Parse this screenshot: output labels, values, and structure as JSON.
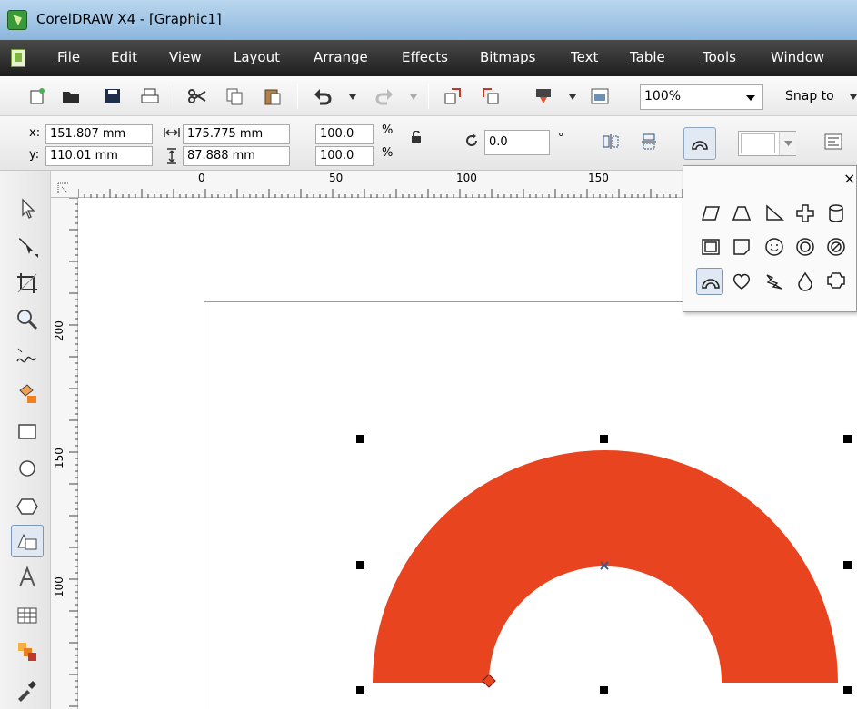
{
  "window": {
    "title": "CorelDRAW X4 - [Graphic1]"
  },
  "menu": [
    "File",
    "Edit",
    "View",
    "Layout",
    "Arrange",
    "Effects",
    "Bitmaps",
    "Text",
    "Table",
    "Tools",
    "Window"
  ],
  "toolbar": {
    "zoom": "100%",
    "snap_label": "Snap to"
  },
  "property_bar": {
    "x_label": "x:",
    "x_value": "151.807 mm",
    "y_label": "y:",
    "y_value": "110.01 mm",
    "width_value": "175.775 mm",
    "height_value": "87.888 mm",
    "scale_x": "100.0",
    "scale_y": "100.0",
    "percent": "%",
    "rotation": "0.0",
    "degree": "°"
  },
  "ruler": {
    "top_labels": [
      "0",
      "50",
      "100",
      "150"
    ],
    "left_labels": [
      "200",
      "150",
      "100"
    ]
  },
  "flyout": {
    "close_label": "×",
    "icons": [
      "parallelogram-icon",
      "trapezoid-icon",
      "right-triangle-icon",
      "cross-icon",
      "cylinder-icon",
      "frame-icon",
      "folded-corner-icon",
      "smiley-icon",
      "donut-icon",
      "no-symbol-icon",
      "arch-icon",
      "heart-icon",
      "lightning-icon",
      "teardrop-icon",
      "octagon-icon"
    ]
  },
  "shape": {
    "fill_color": "#e8441f",
    "type": "arch"
  },
  "colors": {
    "menubar": "#2a2a2a",
    "accent": "#e8441f"
  }
}
